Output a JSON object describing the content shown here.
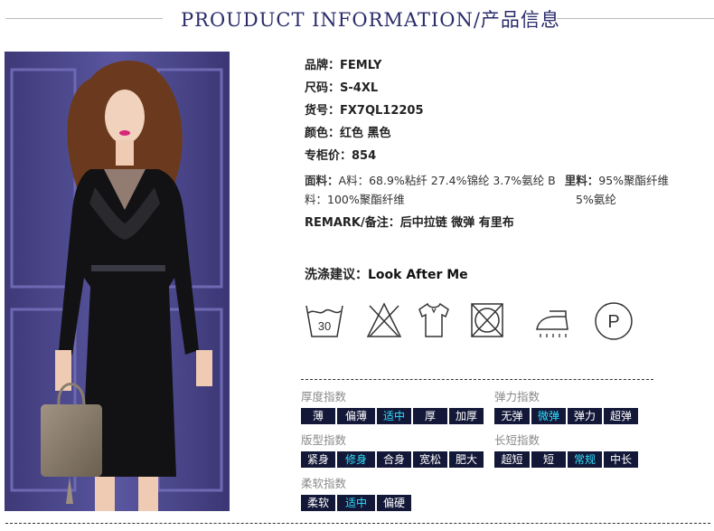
{
  "header": {
    "title": "PROUDUCT INFORMATION/产品信息"
  },
  "info": {
    "brand": {
      "label": "品牌：",
      "value": "FEMLY"
    },
    "size": {
      "label": "尺码：",
      "value": "S-4XL"
    },
    "sku": {
      "label": "货号：",
      "value": "FX7QL12205"
    },
    "color": {
      "label": "颜色：",
      "value": "红色 黑色"
    },
    "price": {
      "label": "专柜价：",
      "value": "854"
    },
    "fabric": {
      "line1_label": "面料：",
      "line1_value": "A料：68.9%粘纤 27.4%锦纶 3.7%氨纶 B",
      "line1_label2": "里料：",
      "line1_value2": "95%聚酯纤维",
      "line2_value": "料：100%聚酯纤维",
      "line2_value2": "5%氨纶"
    },
    "remark": {
      "label": "REMARK/备注：",
      "value": "后中拉链 微弹 有里布"
    }
  },
  "washing": {
    "label": "洗涤建议：",
    "value": "Look After Me",
    "temp": "30",
    "dry_clean": "P"
  },
  "care_icons": [
    "wash-30-icon",
    "no-bleach-icon",
    "hang-dry-icon",
    "no-tumble-dry-icon",
    "iron-icon",
    "dry-clean-p-icon"
  ],
  "indices": {
    "thickness": {
      "label": "厚度指数",
      "options": [
        "薄",
        "偏薄",
        "适中",
        "厚",
        "加厚"
      ],
      "selected": "适中"
    },
    "elasticity": {
      "label": "弹力指数",
      "options": [
        "无弹",
        "微弹",
        "弹力",
        "超弹"
      ],
      "selected": "微弹"
    },
    "fit": {
      "label": "版型指数",
      "options": [
        "紧身",
        "修身",
        "合身",
        "宽松",
        "肥大"
      ],
      "selected": "修身"
    },
    "length": {
      "label": "长短指数",
      "options": [
        "超短",
        "短",
        "常规",
        "中长"
      ],
      "selected": "常规"
    },
    "softness": {
      "label": "柔软指数",
      "options": [
        "柔软",
        "适中",
        "偏硬"
      ],
      "selected": "适中"
    }
  },
  "colors": {
    "chip_bg": "#141838",
    "chip_on": "#2ee0ff",
    "title": "#2a2c6a"
  }
}
